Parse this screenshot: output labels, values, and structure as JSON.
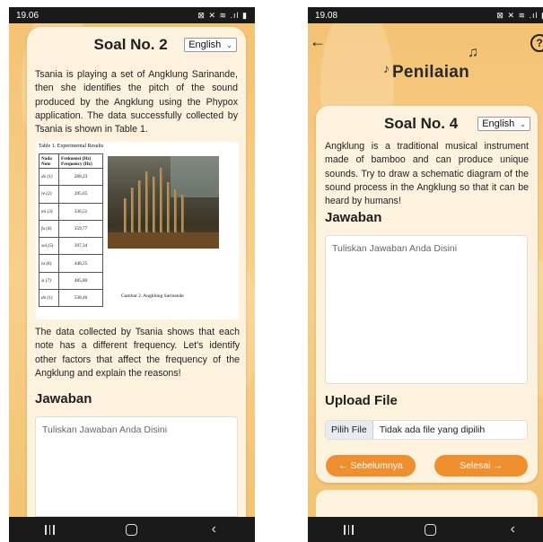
{
  "left_screen": {
    "status": {
      "time": "19.06",
      "icons": "⊠ ✕ ≋ .ıl ▮"
    },
    "title": "Soal No. 2",
    "language": "English",
    "question_intro": "Tsania is playing a set of Angklung Sarinande, then she identifies the pitch of the sound produced by the Angklung using the Phypox application. The data successfully collected by Tsania is shown in Table 1.",
    "figure": {
      "table_caption": "Table 1. Experimental Results",
      "headers": {
        "note": "Nada Note",
        "freq": "Frekuensi (Hz) Frequency (Hz)"
      },
      "rows": [
        {
          "note": "do (1)",
          "freq": "268,23"
        },
        {
          "note": "re (2)",
          "freq": "295,65"
        },
        {
          "note": "mi (3)",
          "freq": "336,51"
        },
        {
          "note": "fa (4)",
          "freq": "359,77"
        },
        {
          "note": "sol (5)",
          "freq": "397,34"
        },
        {
          "note": "la (6)",
          "freq": "448,25"
        },
        {
          "note": "si (7)",
          "freq": "485,80"
        },
        {
          "note": "do (1)",
          "freq": "538,46"
        }
      ],
      "image_caption": "Gambar 2. Angklung Sarinande"
    },
    "question_followup": "The data collected by Tsania shows that each note has a different frequency. Let's identify other factors that affect the frequency of the Angklung and explain the reasons!",
    "answer_heading": "Jawaban",
    "answer_placeholder": "Tuliskan Jawaban Anda Disini"
  },
  "right_screen": {
    "status": {
      "time": "19.08",
      "icons": "⊠ ✕ ≋ .ıl ▮"
    },
    "page_title": "Penilaian",
    "help_icon": "?",
    "title": "Soal No. 4",
    "language": "English",
    "question": "Angklung is a traditional musical instrument made of bamboo and can produce unique sounds. Try to draw a schematic diagram of the sound process in the Angklung so that it can be heard by humans!",
    "answer_heading": "Jawaban",
    "answer_placeholder": "Tuliskan Jawaban Anda Disini",
    "upload_heading": "Upload File",
    "upload_button": "Pilih File",
    "upload_status": "Tidak ada file yang dipilih",
    "prev_button": "← Sebelumnya",
    "finish_button": "Selesai →",
    "accent": "#ef8f2f"
  },
  "navbar": {
    "recents_icon": "recents",
    "home_icon": "home",
    "back_icon": "‹"
  }
}
